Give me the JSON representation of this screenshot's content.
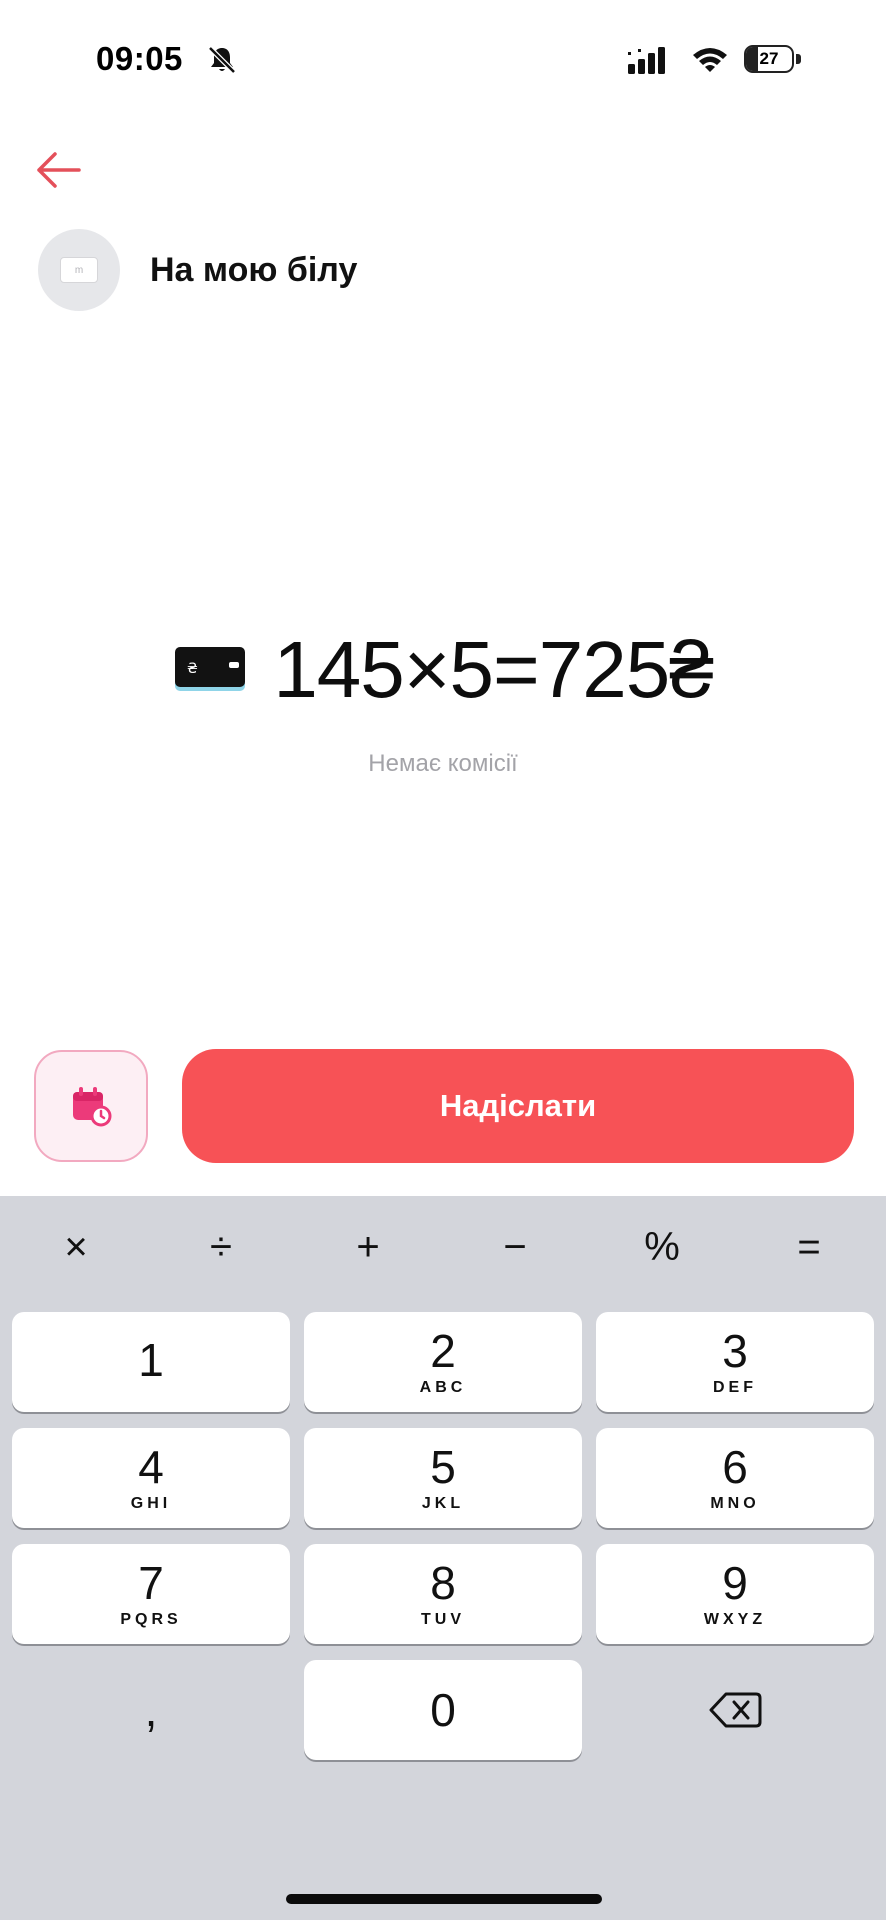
{
  "status_bar": {
    "time": "09:05",
    "battery": "27",
    "battery_level": 0.27
  },
  "header": {
    "recipient_name": "На мою білу",
    "avatar_card_text": "m"
  },
  "amount": {
    "expression": "145×5=725₴",
    "card_icon_text": "₴"
  },
  "commission_text": "Немає комісії",
  "actions": {
    "send_label": "Надіслати"
  },
  "keyboard": {
    "ops": [
      "×",
      "÷",
      "+",
      "−",
      "%",
      "="
    ],
    "keys": [
      {
        "digit": "1",
        "letters": ""
      },
      {
        "digit": "2",
        "letters": "ABC"
      },
      {
        "digit": "3",
        "letters": "DEF"
      },
      {
        "digit": "4",
        "letters": "GHI"
      },
      {
        "digit": "5",
        "letters": "JKL"
      },
      {
        "digit": "6",
        "letters": "MNO"
      },
      {
        "digit": "7",
        "letters": "PQRS"
      },
      {
        "digit": "8",
        "letters": "TUV"
      },
      {
        "digit": "9",
        "letters": "WXYZ"
      }
    ],
    "comma": ",",
    "zero": "0"
  },
  "colors": {
    "accent": "#f75256",
    "back_arrow": "#e4505a",
    "schedule_icon": "#ec3a7a"
  },
  "icons": [
    "bell-slash-icon",
    "signal-icon",
    "wifi-icon",
    "battery-icon",
    "back-arrow-icon",
    "card-icon",
    "calendar-clock-icon",
    "backspace-icon"
  ]
}
